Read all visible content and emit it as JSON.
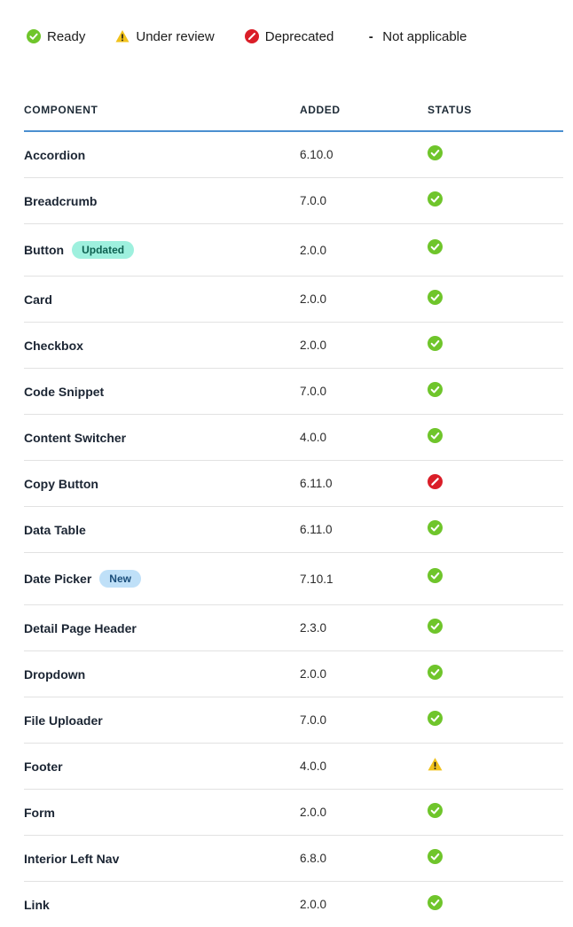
{
  "colors": {
    "ready": "#6fc52b",
    "under_review": "#f1c21b",
    "deprecated": "#da1e28",
    "header_rule": "#4b8fd0",
    "badge_updated_bg": "#9ef0de",
    "badge_new_bg": "#bfe0f8"
  },
  "legend": [
    {
      "icon": "check-circle-icon",
      "label": "Ready"
    },
    {
      "icon": "warning-triangle-icon",
      "label": "Under review"
    },
    {
      "icon": "deprecated-icon",
      "label": "Deprecated"
    },
    {
      "icon": "dash-icon",
      "label": "Not applicable"
    }
  ],
  "table": {
    "headers": {
      "component": "COMPONENT",
      "added": "ADDED",
      "status": "STATUS"
    },
    "rows": [
      {
        "component": "Accordion",
        "added": "6.10.0",
        "status": "ready"
      },
      {
        "component": "Breadcrumb",
        "added": "7.0.0",
        "status": "ready"
      },
      {
        "component": "Button",
        "badge": "Updated",
        "badge_type": "updated",
        "added": "2.0.0",
        "status": "ready"
      },
      {
        "component": "Card",
        "added": "2.0.0",
        "status": "ready"
      },
      {
        "component": "Checkbox",
        "added": "2.0.0",
        "status": "ready"
      },
      {
        "component": "Code Snippet",
        "added": "7.0.0",
        "status": "ready"
      },
      {
        "component": "Content Switcher",
        "added": "4.0.0",
        "status": "ready"
      },
      {
        "component": "Copy Button",
        "added": "6.11.0",
        "status": "deprecated"
      },
      {
        "component": "Data Table",
        "added": "6.11.0",
        "status": "ready"
      },
      {
        "component": "Date Picker",
        "badge": "New",
        "badge_type": "new",
        "added": "7.10.1",
        "status": "ready"
      },
      {
        "component": "Detail Page Header",
        "added": "2.3.0",
        "status": "ready"
      },
      {
        "component": "Dropdown",
        "added": "2.0.0",
        "status": "ready"
      },
      {
        "component": "File Uploader",
        "added": "7.0.0",
        "status": "ready"
      },
      {
        "component": "Footer",
        "added": "4.0.0",
        "status": "under_review"
      },
      {
        "component": "Form",
        "added": "2.0.0",
        "status": "ready"
      },
      {
        "component": "Interior Left Nav",
        "added": "6.8.0",
        "status": "ready"
      },
      {
        "component": "Link",
        "added": "2.0.0",
        "status": "ready"
      }
    ]
  }
}
